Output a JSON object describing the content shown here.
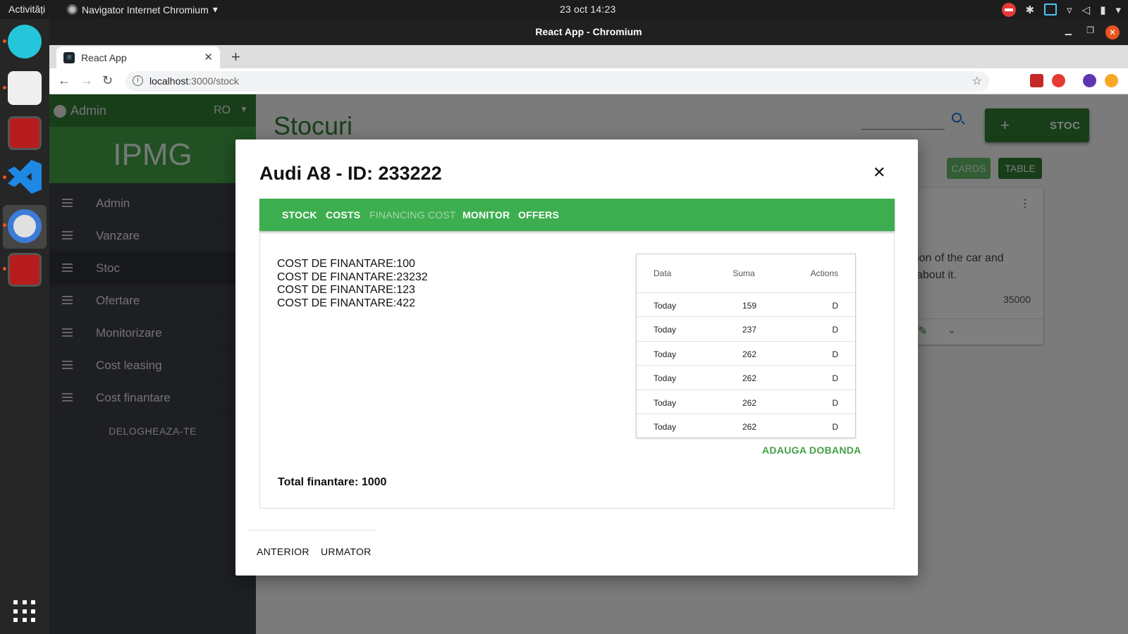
{
  "os": {
    "activities": "Activități",
    "app_menu": "Navigator Internet Chromium",
    "clock": "23 oct  14:23"
  },
  "browser": {
    "window_title": "React App - Chromium",
    "tab_title": "React App",
    "url_host": "localhost",
    "url_path": ":3000/stock"
  },
  "sidebar": {
    "user": "Admin",
    "lang": "RO",
    "brand": "IPMG",
    "items": [
      {
        "label": "Admin"
      },
      {
        "label": "Vanzare"
      },
      {
        "label": "Stoc"
      },
      {
        "label": "Ofertare"
      },
      {
        "label": "Monitorizare"
      },
      {
        "label": "Cost leasing"
      },
      {
        "label": "Cost finantare"
      }
    ],
    "logout": "DELOGHEAZA-TE"
  },
  "main": {
    "title": "Stocuri",
    "add_button": "STOC",
    "view_cards": "CARDS",
    "view_table": "TABLE",
    "card_desc_line1": "ion of the car and",
    "card_desc_line2": "about it.",
    "card_price": "35000"
  },
  "modal": {
    "title": "Audi A8 - ID: 233222",
    "tabs": [
      "STOCK",
      "COSTS",
      "FINANCING COST",
      "MONITOR",
      "OFFERS"
    ],
    "selected_tab": "FINANCING COST",
    "costs": [
      "COST DE FINANTARE:100",
      "COST DE FINANTARE:23232",
      "COST DE FINANTARE:123",
      "COST DE FINANTARE:422"
    ],
    "total": "Total finantare: 1000",
    "table": {
      "headers": [
        "Data",
        "Suma",
        "Actions"
      ],
      "rows": [
        [
          "Today",
          "159",
          "D"
        ],
        [
          "Today",
          "237",
          "D"
        ],
        [
          "Today",
          "262",
          "D"
        ],
        [
          "Today",
          "262",
          "D"
        ],
        [
          "Today",
          "262",
          "D"
        ],
        [
          "Today",
          "262",
          "D"
        ]
      ]
    },
    "add_interest": "ADAUGA DOBANDA",
    "prev": "ANTERIOR",
    "next": "URMATOR"
  },
  "colors": {
    "primary_green": "#2e7d32",
    "tab_green": "#3dae4f",
    "sidebar": "#3a3f46"
  }
}
